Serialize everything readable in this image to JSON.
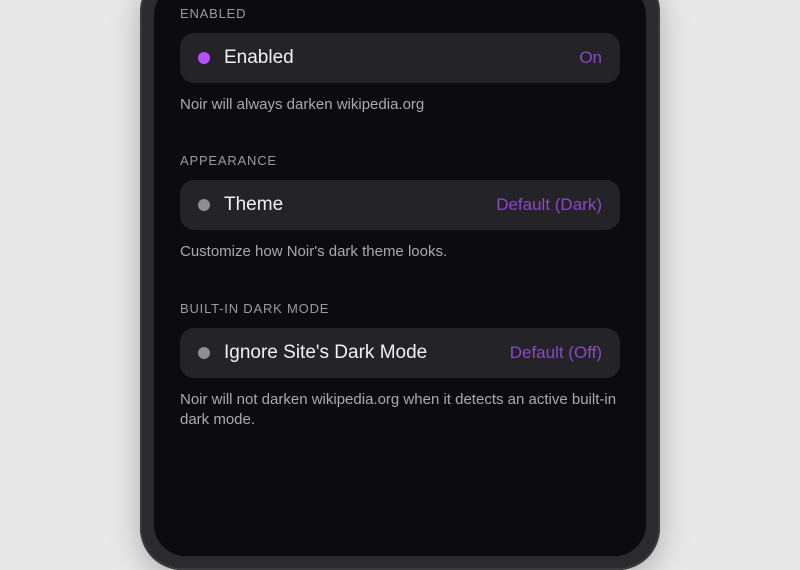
{
  "sections": {
    "enabled": {
      "header": "ENABLED",
      "row_label": "Enabled",
      "row_value": "On",
      "description": "Noir will always darken wikipedia.org"
    },
    "appearance": {
      "header": "APPEARANCE",
      "row_label": "Theme",
      "row_value": "Default (Dark)",
      "description": "Customize how Noir's dark theme looks."
    },
    "builtin": {
      "header": "BUILT-IN DARK MODE",
      "row_label": "Ignore Site's Dark Mode",
      "row_value": "Default (Off)",
      "description": "Noir will not darken wikipedia.org when it detects an active built-in dark mode."
    }
  }
}
